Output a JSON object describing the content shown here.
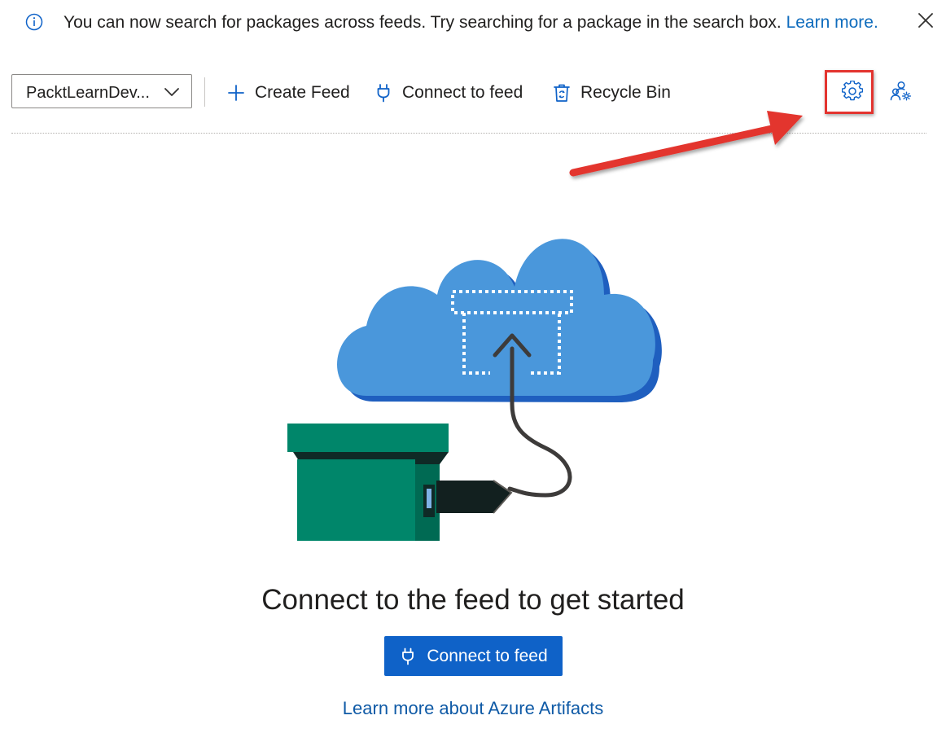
{
  "banner": {
    "message": "You can now search for packages across feeds. Try searching for a package in the search box.",
    "link": "Learn more.",
    "info_icon": "info-icon",
    "close_icon": "close-icon"
  },
  "toolbar": {
    "feed_selector": {
      "selected": "PacktLearnDev...",
      "icon": "chevron-down-icon"
    },
    "create_feed": {
      "label": "Create Feed",
      "icon": "plus-icon"
    },
    "connect_feed": {
      "label": "Connect to feed",
      "icon": "plug-icon"
    },
    "recycle_bin": {
      "label": "Recycle Bin",
      "icon": "recycle-bin-icon"
    },
    "settings_icon": "gear-icon",
    "permissions_icon": "users-settings-icon"
  },
  "empty_state": {
    "title": "Connect to the feed to get started",
    "primary_button": {
      "label": "Connect to feed",
      "icon": "plug-icon"
    },
    "link": "Learn more about Azure Artifacts"
  },
  "colors": {
    "accent": "#0f62c8",
    "link": "#0f6cbd",
    "annotation": "#e3342f",
    "cloud": "#4a97db",
    "package": "#00866a"
  }
}
